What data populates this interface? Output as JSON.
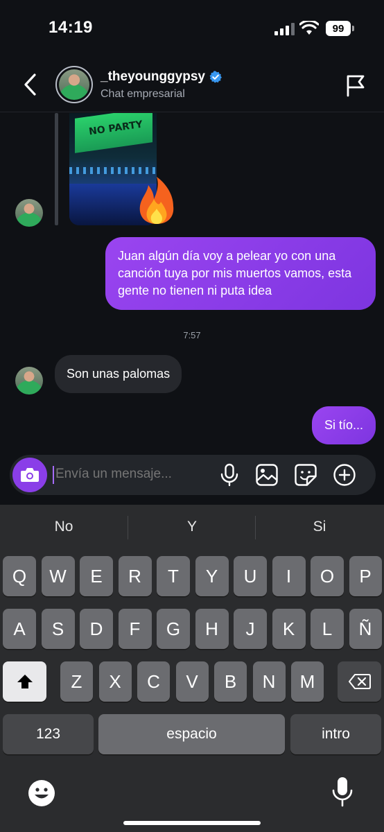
{
  "status_bar": {
    "time": "14:19",
    "battery": "99"
  },
  "header": {
    "username": "_theyounggypsy",
    "subtitle": "Chat empresarial"
  },
  "shared_image": {
    "banner_text": "NO PARTY"
  },
  "messages": [
    {
      "sender": "me",
      "text": "Juan algún día voy a pelear yo con una canción tuya por mis muertos vamos, esta gente no tienen ni puta idea"
    },
    {
      "sender": "them",
      "text": "Son unas palomas"
    },
    {
      "sender": "me",
      "text": "Si tío..."
    }
  ],
  "timestamp": "7:57",
  "composer": {
    "placeholder": "Envía un mensaje..."
  },
  "keyboard": {
    "suggestions": [
      "No",
      "Y",
      "Si"
    ],
    "row1": [
      "Q",
      "W",
      "E",
      "R",
      "T",
      "Y",
      "U",
      "I",
      "O",
      "P"
    ],
    "row2": [
      "A",
      "S",
      "D",
      "F",
      "G",
      "H",
      "J",
      "K",
      "L",
      "Ñ"
    ],
    "row3": [
      "Z",
      "X",
      "C",
      "V",
      "B",
      "N",
      "M"
    ],
    "numbers_label": "123",
    "space_label": "espacio",
    "return_label": "intro"
  },
  "colors": {
    "accent": "#8a3ee8",
    "background": "#0f1115",
    "received_bubble": "#26282d"
  }
}
